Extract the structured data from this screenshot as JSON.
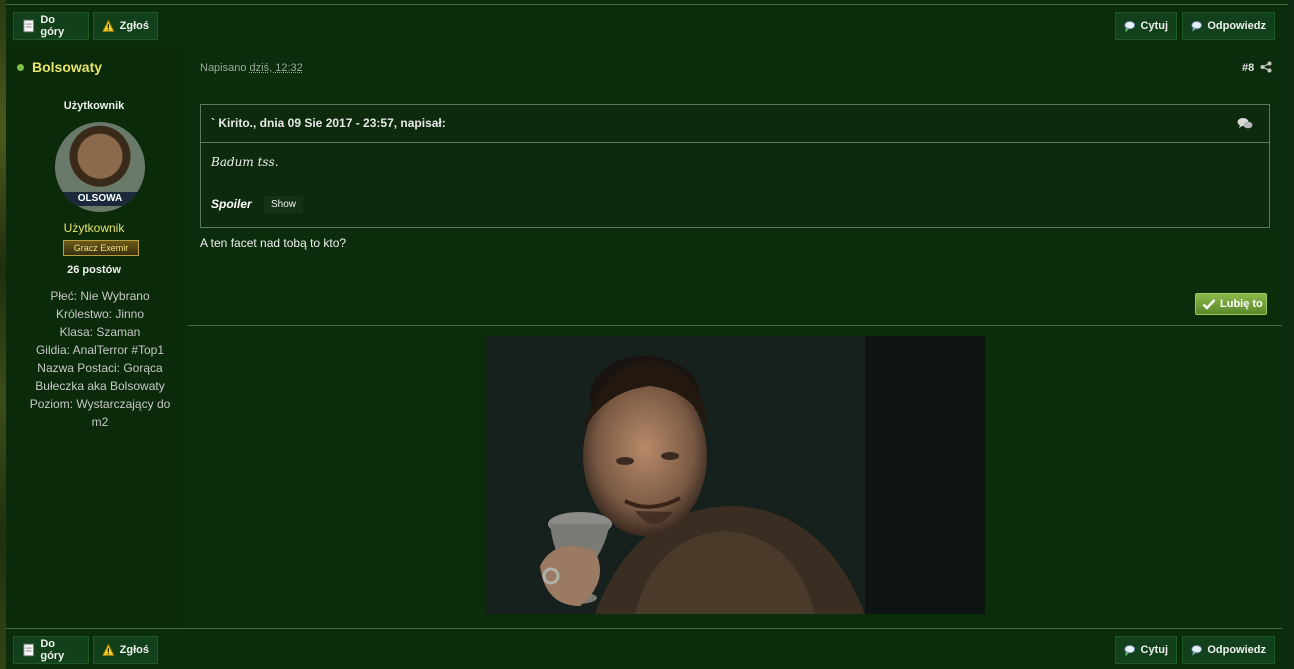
{
  "toolbar": {
    "top_label": "Do góry",
    "report_label": "Zgłoś",
    "quote_label": "Cytuj",
    "reply_label": "Odpowiedz"
  },
  "author": {
    "name": "Bolsowaty",
    "title": "Użytkownik",
    "avatar_caption": "OLSOWA",
    "group": "Użytkownik",
    "rank_badge": "Gracz Exemir",
    "post_count": "26 postów",
    "info": [
      "Płeć: Nie Wybrano",
      "Królestwo: Jinno",
      "Klasa: Szaman",
      "Gildia: AnalTerror #Top1",
      "Nazwa Postaci: Gorąca",
      "Bułeczka aka Bolsowaty",
      "Poziom: Wystarczający do",
      "m2"
    ]
  },
  "post": {
    "meta_prefix": "Napisano",
    "timestamp": "dziś, 12:32",
    "number": "#8",
    "quote_header": "` Kirito., dnia 09 Sie 2017 - 23:57, napisał:",
    "quote_text": "Badum tss.",
    "spoiler_label": "Spoiler",
    "spoiler_button": "Show",
    "text": "A ten facet nad tobą to kto?",
    "like_label": "Lubię to"
  },
  "colors": {
    "background": "#0b2d0b",
    "accent_name": "#e8e46a",
    "online": "#7cc04a",
    "like_button": "#7aa83a"
  }
}
